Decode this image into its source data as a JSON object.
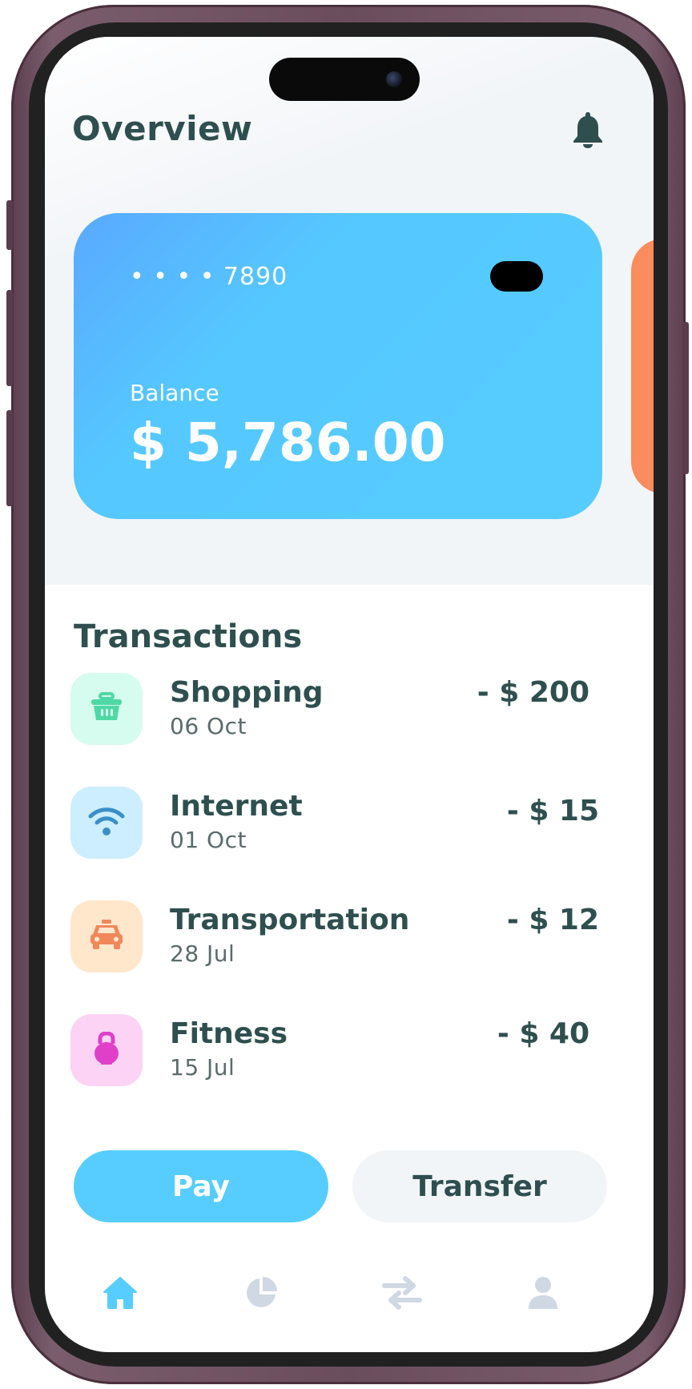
{
  "colors": {
    "accent": "#56cdfe",
    "text_primary": "#2f4f4f",
    "card_secondary": "#fa8c5e",
    "tab_inactive": "#cfd8e3"
  },
  "header": {
    "title": "Overview",
    "notification_icon": "bell-icon"
  },
  "card": {
    "number": "• • • •  7890",
    "balance_label": "Balance",
    "balance_value": "$ 5,786.00"
  },
  "transactions": {
    "title": "Transactions",
    "items": [
      {
        "name": "Shopping",
        "date": "06 Oct",
        "amount": "- $ 200",
        "icon": "shopping-basket-icon",
        "icon_bg": "#d6fbef",
        "icon_color": "#4fd8a5"
      },
      {
        "name": "Internet",
        "date": "01 Oct",
        "amount": "- $ 15",
        "icon": "wifi-icon",
        "icon_bg": "#cdeefe",
        "icon_color": "#3a90c8"
      },
      {
        "name": "Transportation",
        "date": "28 Jul",
        "amount": "- $ 12",
        "icon": "taxi-icon",
        "icon_bg": "#ffe7cc",
        "icon_color": "#f0885a"
      },
      {
        "name": "Fitness",
        "date": "15 Jul",
        "amount": "- $ 40",
        "icon": "kettlebell-icon",
        "icon_bg": "#fcd3f4",
        "icon_color": "#e040c8"
      }
    ]
  },
  "actions": {
    "pay_label": "Pay",
    "transfer_label": "Transfer"
  },
  "tabbar": {
    "items": [
      {
        "icon": "home-icon",
        "active": true
      },
      {
        "icon": "pie-chart-icon",
        "active": false
      },
      {
        "icon": "transfer-arrows-icon",
        "active": false
      },
      {
        "icon": "user-icon",
        "active": false
      }
    ]
  }
}
